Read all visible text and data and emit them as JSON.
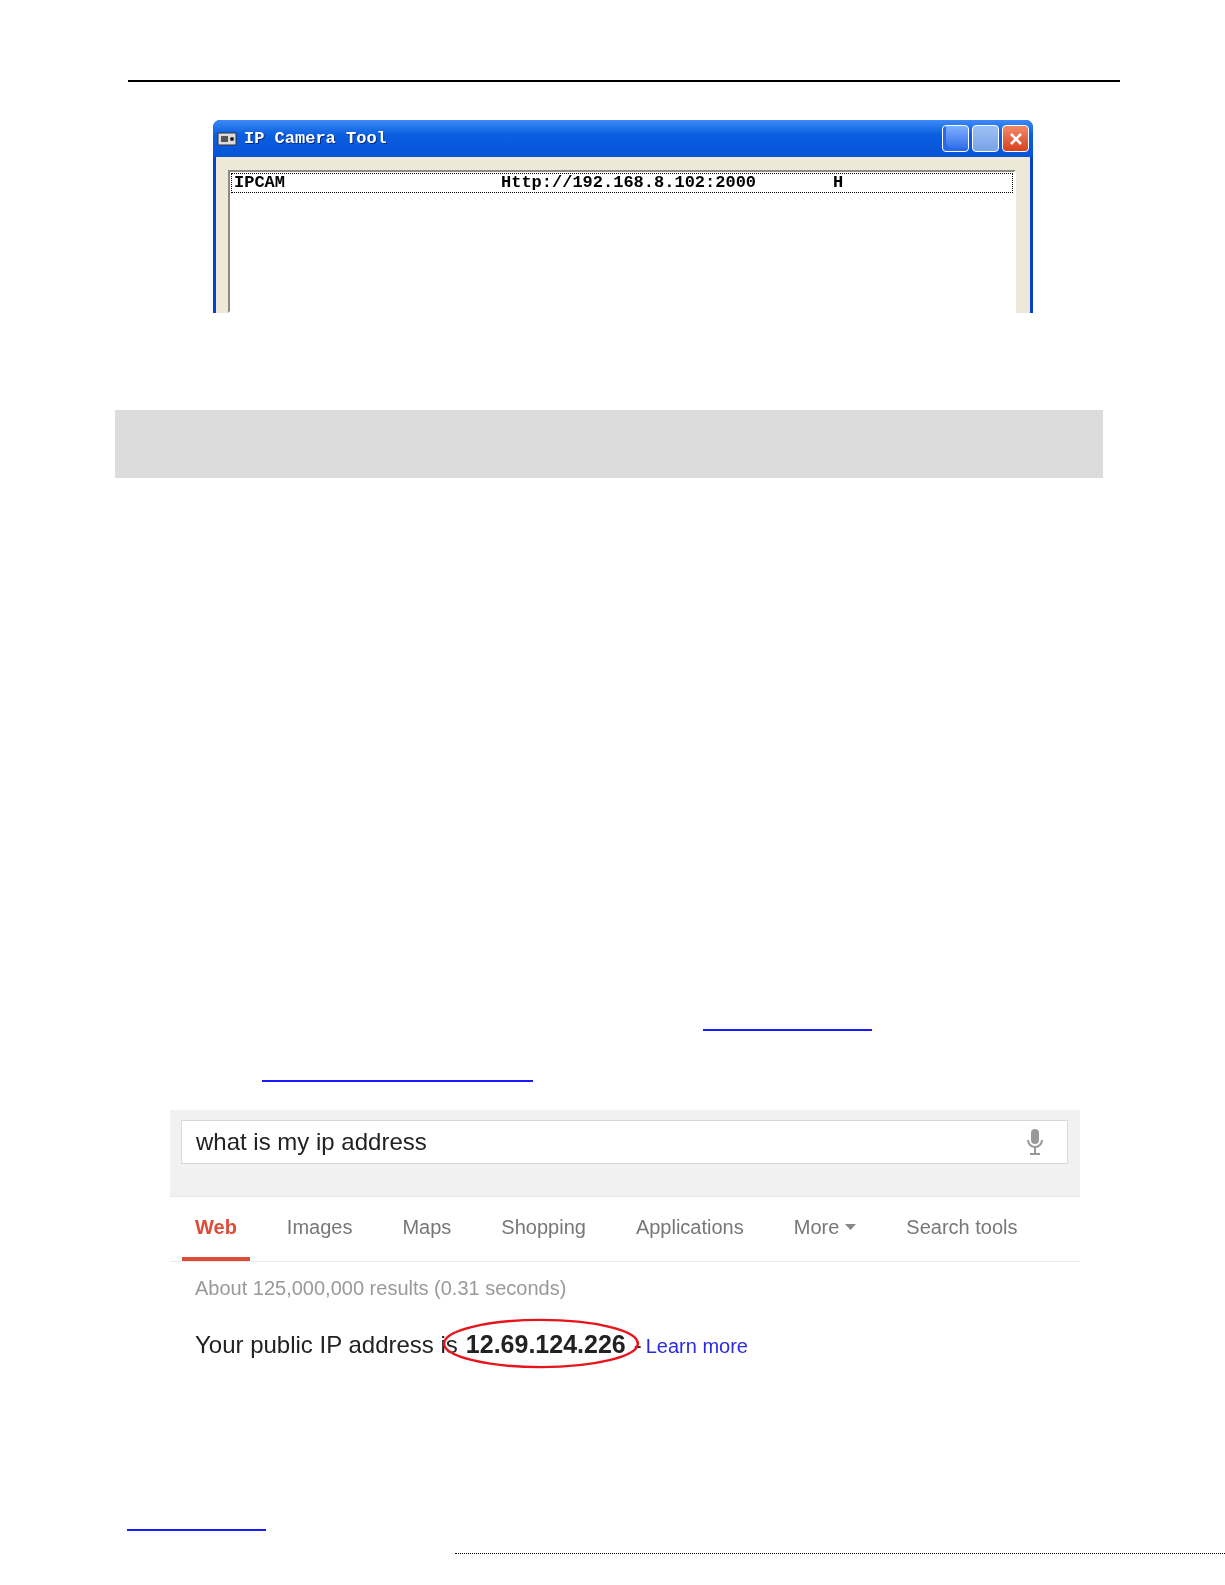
{
  "camera_window": {
    "title": "IP Camera Tool",
    "devices": [
      {
        "name": "IPCAM",
        "url": "Http://192.168.8.102:2000",
        "column_3": "H",
        "selected": true
      }
    ]
  },
  "search_page": {
    "query": "what is my ip address",
    "tabs": [
      {
        "label": "Web",
        "selected": true,
        "dropdown": false
      },
      {
        "label": "Images",
        "selected": false,
        "dropdown": false
      },
      {
        "label": "Maps",
        "selected": false,
        "dropdown": false
      },
      {
        "label": "Shopping",
        "selected": false,
        "dropdown": false
      },
      {
        "label": "Applications",
        "selected": false,
        "dropdown": false
      },
      {
        "label": "More",
        "selected": false,
        "dropdown": true
      },
      {
        "label": "Search tools",
        "selected": false,
        "dropdown": false
      }
    ],
    "result_stats": "About 125,000,000 results (0.31 seconds)",
    "answer": {
      "text": "Your public IP address is",
      "value": "12.69.124.226",
      "separator": "-",
      "link": "Learn more",
      "highlighted": true
    }
  }
}
